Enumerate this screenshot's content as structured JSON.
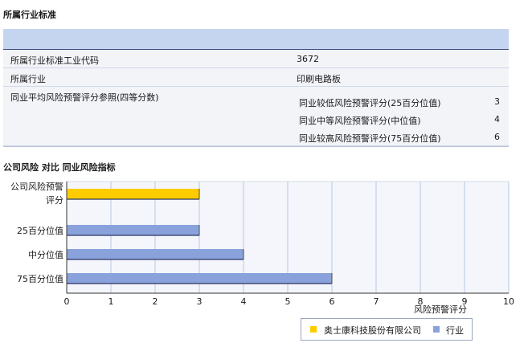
{
  "section1_title": "所属行业标准",
  "info": {
    "industry_code_label": "所属行业标准工业代码",
    "industry_code_value": "3672",
    "industry_label": "所属行业",
    "industry_value": "印刷电路板",
    "avg_label": "同业平均风险预警评分参照(四等分数)",
    "percentiles": [
      {
        "label": "同业较低风险预警评分(25百分位值)",
        "value": "3"
      },
      {
        "label": "同业中等风险预警评分(中位值)",
        "value": "4"
      },
      {
        "label": "同业较高风险预警评分(75百分位值)",
        "value": "6"
      }
    ]
  },
  "section2_title": "公司风险 对比 同业风险指标",
  "chart_data": {
    "type": "bar",
    "orientation": "horizontal",
    "categories": [
      "公司风险预警评分",
      "25百分位值",
      "中分位值",
      "75百分位值"
    ],
    "category_lines": [
      [
        "公司风险预警",
        "评分"
      ],
      [
        "25百分位值"
      ],
      [
        "中分位值"
      ],
      [
        "75百分位值"
      ]
    ],
    "values": [
      3,
      3,
      4,
      6
    ],
    "bar_series": [
      "奥士康科技股份有限公司",
      "行业",
      "行业",
      "行业"
    ],
    "xlim": [
      0,
      10
    ],
    "xticks": [
      "0",
      "1",
      "2",
      "3",
      "4",
      "5",
      "6",
      "7",
      "8",
      "9",
      "10"
    ],
    "xlabel": "风险预警评分",
    "grid": true,
    "legend": [
      {
        "name": "奥士康科技股份有限公司",
        "color": "#ffcc00"
      },
      {
        "name": "行业",
        "color": "#8aa2dc"
      }
    ]
  }
}
